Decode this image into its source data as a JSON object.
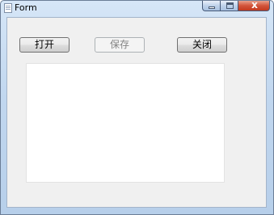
{
  "window": {
    "title": "Form",
    "close_glyph": "x",
    "icons": {
      "app": "form-app-icon",
      "minimize": "minimize-icon",
      "maximize": "maximize-icon",
      "close": "close-icon"
    }
  },
  "toolbar": {
    "open_label": "打开",
    "save_label": "保存",
    "save_enabled": false,
    "close_label": "关闭"
  },
  "editor": {
    "value": ""
  }
}
